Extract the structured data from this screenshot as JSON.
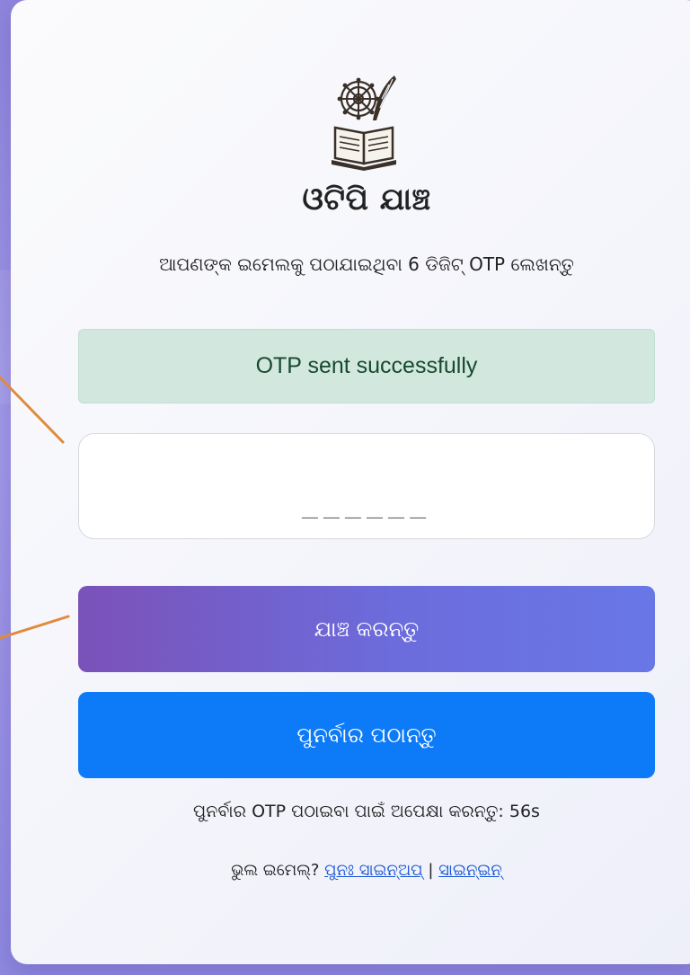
{
  "header": {
    "title": "ଓଟିପି ଯାଞ୍ଚ",
    "subtitle": "ଆପଣଙ୍କ ଇମେଲକୁ ପଠାଯାଇଥିବା 6 ଡିଜିଟ୍ OTP ଲେଖନ୍ତୁ"
  },
  "alert": {
    "message": "OTP sent successfully",
    "status_color": "#d2e8df"
  },
  "otp_input": {
    "value": "",
    "placeholder": "______"
  },
  "buttons": {
    "verify_label": "ଯାଞ୍ଚ କରନ୍ତୁ",
    "resend_label": "ପୁନର୍ବାର ପଠାନ୍ତୁ"
  },
  "countdown": {
    "text": "ପୁନର୍ବାର OTP ପଠାଇବା ପାଇଁ ଅପେକ୍ଷା କରନ୍ତୁ: 56s"
  },
  "footer": {
    "prefix": "ଭୁଲ ଇମେଲ୍?",
    "signup_link": "ପୁନଃ ସାଇନ୍ଅପ୍",
    "separator": "|",
    "signin_link": "ସାଇନ୍ଇନ୍"
  },
  "colors": {
    "accent_gradient_start": "#7b52b8",
    "accent_gradient_end": "#6977e6",
    "resend_button": "#0d7bf7",
    "link": "#1a56d6",
    "annotation_arrow": "#e08a3c"
  }
}
